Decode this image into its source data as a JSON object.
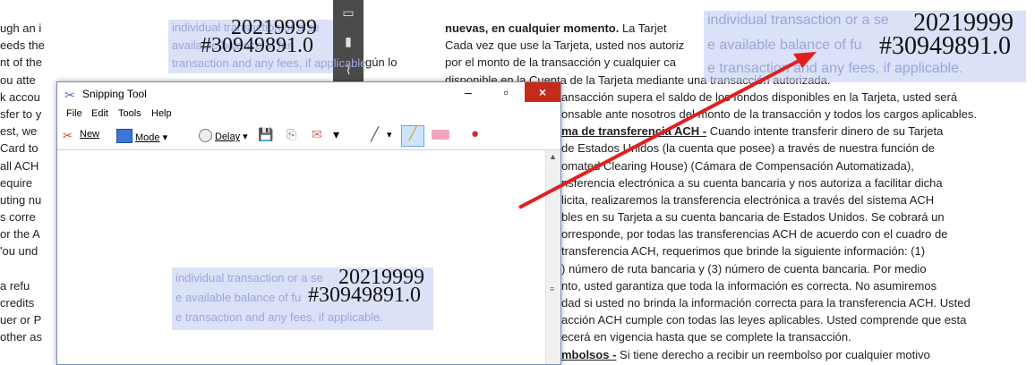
{
  "left_doc": {
    "lines": [
      "ugh an i",
      "eeds the",
      "nt of the",
      "ou atte",
      "k accou",
      "sfer to y",
      "est, we",
      "Card to",
      "all ACH",
      "equire",
      "uting nu",
      "s corre",
      "or the A",
      "'ou und",
      "",
      "a refu",
      "credits",
      "uer or P",
      "other as"
    ]
  },
  "mid_doc": {
    "lines": [
      "",
      "",
      "gún lo"
    ]
  },
  "right_doc": {
    "line1_bold": "nuevas, en cualquier momento.",
    "line1_rest": " La Tarjet",
    "lines": [
      "Cada vez que use la Tarjeta, usted nos autoriz",
      "por el monto de la transacción y cualquier ca",
      "disponible en la Cuenta de la Tarjeta mediante una transacción autorizada.",
      "ansacción supera el saldo de los fondos disponibles en la Tarjeta, usted será",
      "onsable ante nosotros del monto de la transacción y todos los cargos aplicables."
    ],
    "ach_head": "ma de transferencia ACH -",
    "ach_rest": " Cuando intente transferir dinero de su Tarjeta",
    "lines2": [
      "de Estados Unidos (la cuenta que posee) a través de nuestra función de",
      "omated Clearing House) (Cámara de Compensación Automatizada),",
      "nsferencia electrónica a su cuenta bancaria y nos autoriza a facilitar dicha",
      "licita, realizaremos la transferencia electrónica a través del sistema ACH",
      "bles en su Tarjeta a su cuenta bancaria de Estados Unidos. Se cobrará un",
      "orresponde, por todas las transferencias ACH de acuerdo con el cuadro de",
      "transferencia ACH, requerimos que brinde la siguiente información: (1)",
      ") número de ruta bancaria y (3) número de cuenta bancaria. Por medio",
      "nto, usted garantiza que toda la información es correcta. No asumiremos",
      "dad si usted no brinda la información correcta para la transferencia ACH. Usted",
      "acción ACH cumple con todas las leyes aplicables. Usted comprende que esta",
      "ecerá en vigencia hasta que se complete la transacción."
    ],
    "refund_head": "mbolsos -",
    "refund_rest": " Si tiene derecho a recibir un reembolso por cualquier motivo"
  },
  "overlays": {
    "top_left": {
      "line1": "individual transaction or a se",
      "line2": "available balance of fun",
      "line3": "transaction and any fees, if applicable.",
      "num_top": "20219999",
      "num_bottom": "#30949891.0"
    },
    "top_right": {
      "line1": "individual transaction or a se",
      "line2": "e available balance of fu",
      "line3": "e transaction and any fees, if applicable.",
      "num_top": "20219999",
      "num_bottom": "#30949891.0"
    },
    "center": {
      "line1": "individual transaction or a se",
      "line2": "e available balance of fu",
      "line3": "e transaction and any fees, if applicable.",
      "num_top": "20219999",
      "num_bottom": "#30949891.0"
    }
  },
  "snipping_tool": {
    "title": "Snipping Tool",
    "menu": [
      "File",
      "Edit",
      "Tools",
      "Help"
    ],
    "new_label": "New",
    "mode_label": "Mode",
    "delay_label": "Delay",
    "minimize": "–",
    "maximize": "▫",
    "close": "×"
  },
  "colors": {
    "arrow": "#e02020",
    "overlay": "#c3cbf0",
    "titlebar_close": "#c42b1c"
  }
}
